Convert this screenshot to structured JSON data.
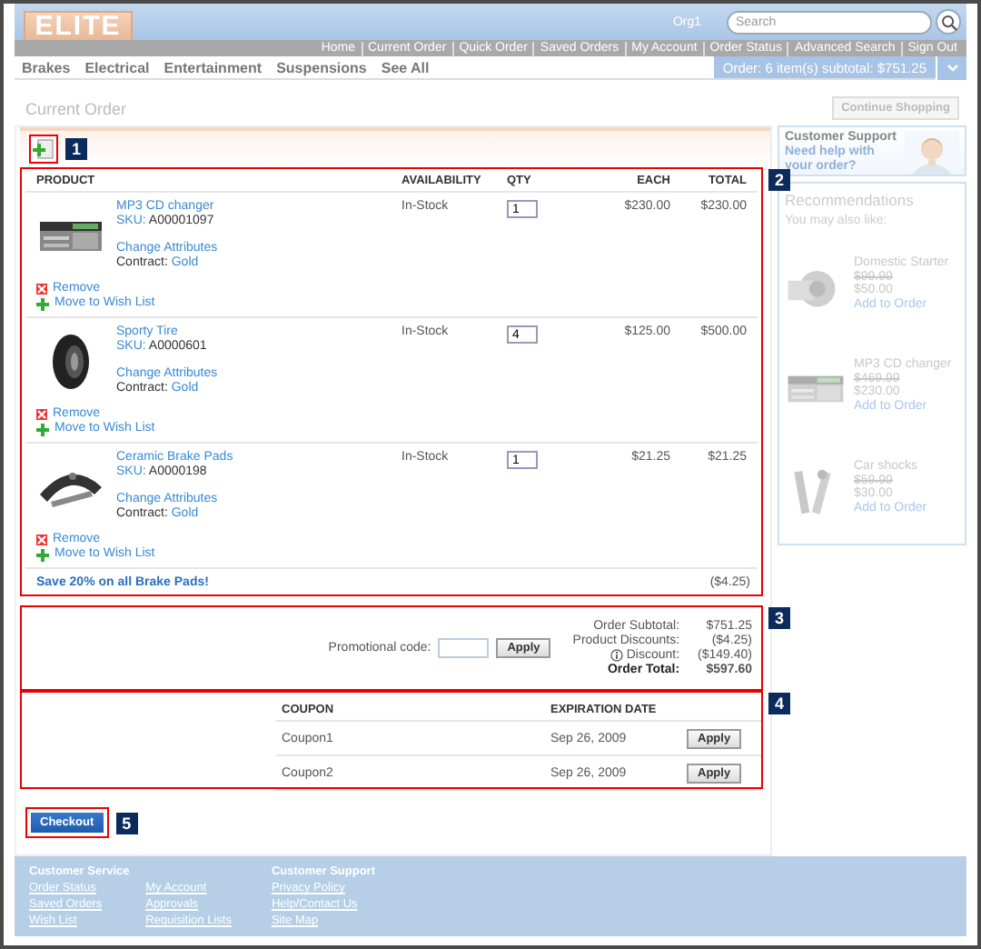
{
  "header": {
    "logo": "ELITE",
    "org": "Org1",
    "search": {
      "placeholder": "Search"
    }
  },
  "nav_links": [
    "Home",
    "Current Order",
    "Quick Order",
    "Saved Orders",
    "My Account",
    "Order Status",
    "Advanced Search",
    "Sign Out"
  ],
  "categories": [
    "Brakes",
    "Electrical",
    "Entertainment",
    "Suspensions",
    "See All"
  ],
  "order_summary": "Order: 6 item(s) subtotal: $751.25",
  "page_title": "Current Order",
  "continue_button": "Continue Shopping",
  "toolbar": {
    "callout": "1"
  },
  "cart": {
    "callout": "2",
    "columns": [
      "PRODUCT",
      "AVAILABILITY",
      "QTY",
      "EACH",
      "TOTAL"
    ],
    "items": [
      {
        "kind": "changer",
        "name": "MP3 CD changer",
        "sku_label": "SKU:",
        "sku": "A00001097",
        "change_link": "Change Attributes",
        "contract_label": "Contract:",
        "contract": "Gold",
        "availability": "In-Stock",
        "qty": "1",
        "each": "$230.00",
        "total": "$230.00",
        "remove": "Remove",
        "wish": "Move to Wish List"
      },
      {
        "kind": "tire",
        "name": "Sporty Tire",
        "sku_label": "SKU:",
        "sku": "A0000601",
        "change_link": "Change Attributes",
        "contract_label": "Contract:",
        "contract": "Gold",
        "availability": "In-Stock",
        "qty": "4",
        "each": "$125.00",
        "total": "$500.00",
        "remove": "Remove",
        "wish": "Move to Wish List"
      },
      {
        "kind": "pads",
        "name": "Ceramic Brake Pads",
        "sku_label": "SKU:",
        "sku": "A0000198",
        "change_link": "Change Attributes",
        "contract_label": "Contract:",
        "contract": "Gold",
        "availability": "In-Stock",
        "qty": "1",
        "each": "$21.25",
        "total": "$21.25",
        "remove": "Remove",
        "wish": "Move to Wish List"
      }
    ],
    "promotion": {
      "text": "Save 20% on all Brake Pads!",
      "amount": "($4.25)"
    }
  },
  "promo": {
    "callout": "3",
    "label": "Promotional code:",
    "button": "Apply",
    "summary": [
      {
        "kind": "plain",
        "label": "Order Subtotal:",
        "value": "$751.25"
      },
      {
        "kind": "plain",
        "label": "Product Discounts:",
        "value": "($4.25)"
      },
      {
        "kind": "info",
        "label": "Discount:",
        "value": "($149.40)"
      },
      {
        "kind": "total",
        "label": "Order Total:",
        "value": "$597.60"
      }
    ]
  },
  "coupons": {
    "callout": "4",
    "columns": [
      "COUPON",
      "EXPIRATION DATE"
    ],
    "rows": [
      {
        "name": "Coupon1",
        "date": "Sep 26, 2009",
        "button": "Apply"
      },
      {
        "name": "Coupon2",
        "date": "Sep 26, 2009",
        "button": "Apply"
      }
    ]
  },
  "checkout": {
    "callout": "5",
    "button": "Checkout"
  },
  "support": {
    "title": "Customer Support",
    "link": "Need help with your order?"
  },
  "recommendations": {
    "title": "Recommendations",
    "subtitle": "You may also like:",
    "items": [
      {
        "kind": "starter",
        "name": "Domestic Starter",
        "old_price": "$99.99",
        "price": "$50.00",
        "link": "Add to Order"
      },
      {
        "kind": "changer",
        "name": "MP3 CD changer",
        "old_price": "$469.99",
        "price": "$230.00",
        "link": "Add to Order"
      },
      {
        "kind": "shocks",
        "name": "Car shocks",
        "old_price": "$59.99",
        "price": "$30.00",
        "link": "Add to Order"
      }
    ]
  },
  "footer": [
    {
      "title": "Customer Service",
      "columns": [
        [
          "Order Status",
          "Saved Orders",
          "Wish List"
        ],
        [
          "My Account",
          "Approvals",
          "Requisition Lists"
        ]
      ]
    },
    {
      "title": "Customer Support",
      "columns": [
        [
          "Privacy Policy",
          "Help/Contact Us",
          "Site Map"
        ]
      ]
    }
  ]
}
